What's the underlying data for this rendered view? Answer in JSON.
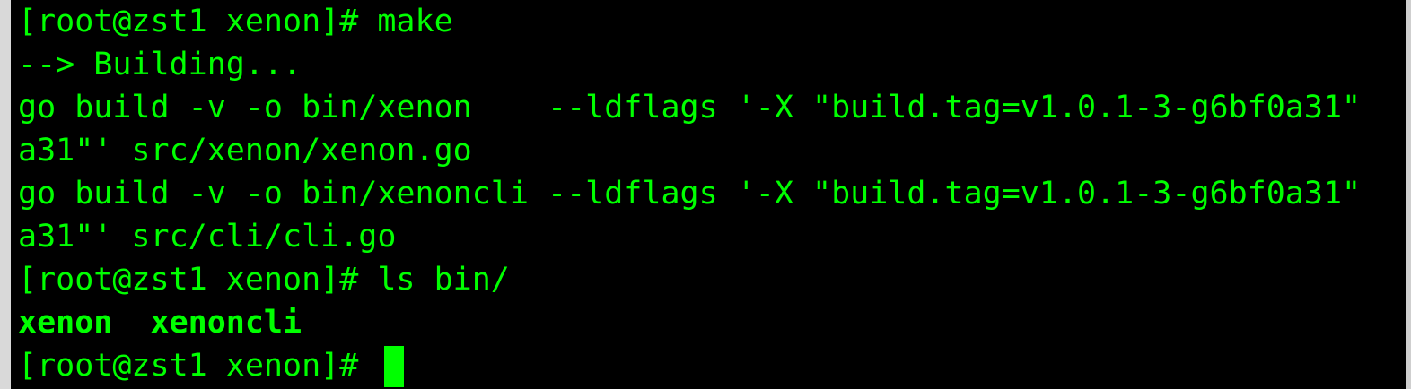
{
  "terminal": {
    "lines": [
      "[root@zst1 xenon]# make",
      "--> Building...",
      "go build -v -o bin/xenon    --ldflags '-X \"build.tag=v1.0.1-3-g6bf0a31\"",
      "a31\"' src/xenon/xenon.go",
      "go build -v -o bin/xenoncli --ldflags '-X \"build.tag=v1.0.1-3-g6bf0a31\"",
      "a31\"' src/cli/cli.go",
      "[root@zst1 xenon]# ls bin/",
      "xenon  xenoncli",
      "[root@zst1 xenon]# "
    ],
    "colors": {
      "background": "#000000",
      "foreground": "#00ff00",
      "cursor": "#00ff00"
    }
  }
}
